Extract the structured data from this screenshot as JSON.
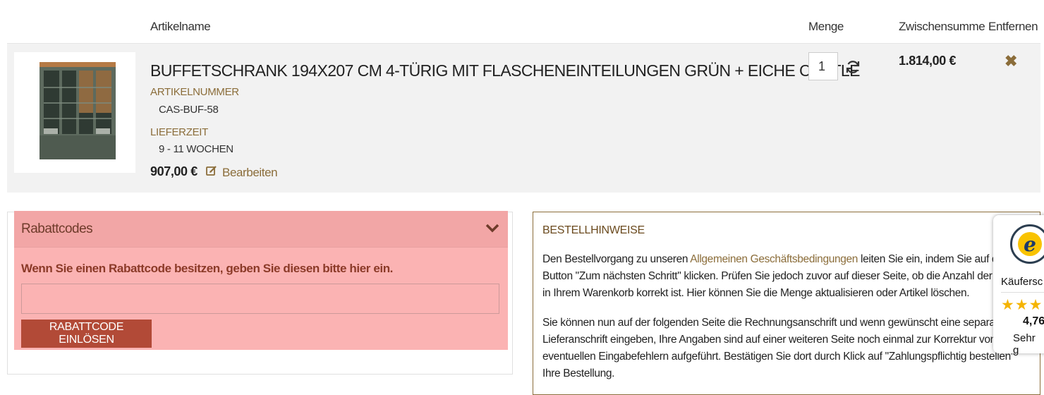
{
  "table_header": {
    "name": "Artikelname",
    "quantity": "Menge",
    "subtotal": "Zwischensumme",
    "remove": "Entfernen"
  },
  "item": {
    "title": "BUFFETSCHRANK 194X207 CM 4-TÜRIG MIT FLASCHENEINTEILUNGEN GRÜN + EICHE CASTLE",
    "sku_label": "ARTIKELNUMMER",
    "sku": "CAS-BUF-58",
    "delivery_label": "LIEFERZEIT",
    "delivery": "9 - 11 WOCHEN",
    "price": "907,00 €",
    "edit_label": "Bearbeiten",
    "quantity": "1",
    "subtotal": "1.814,00 €"
  },
  "coupon": {
    "title": "Rabattcodes",
    "text": "Wenn Sie einen Rabattcode besitzen, geben Sie diesen bitte hier ein.",
    "input_value": "",
    "button_label": "RABATTCODE EINLÖSEN"
  },
  "notes": {
    "title": "BESTELLHINWEISE",
    "p1_before": "Den Bestellvorgang zu unseren ",
    "p1_link": "Allgemeinen Geschäftsbedingungen",
    "p1_after": " leiten Sie ein, indem Sie auf den Button \"Zum nächsten Schritt\" klicken. Prüfen Sie jedoch zuvor auf dieser Seite, ob die Anzahl der Artikel in Ihrem Warenkorb korrekt ist. Hier können Sie die Menge aktualisieren oder Artikel löschen.",
    "p2": "Sie können nun auf der folgenden Seite die Rechnungsanschrift und wenn gewünscht eine separate Lieferanschrift eingeben, Ihre Angaben sind auf einer weiteren Seite noch einmal zur Korrektur von eventuellen Eingabefehlern aufgeführt. Bestätigen Sie dort durch Klick auf \"Zahlungspflichtig bestellen\" Ihre Bestellung."
  },
  "badge": {
    "label": "Käufersc",
    "stars": "★★★",
    "rating": "4,76",
    "rating_text": "Sehr g",
    "seal_letter": "e"
  },
  "colors": {
    "accent": "#8b6d3a",
    "button": "#b24a37",
    "highlight": "#fbb3b3"
  }
}
